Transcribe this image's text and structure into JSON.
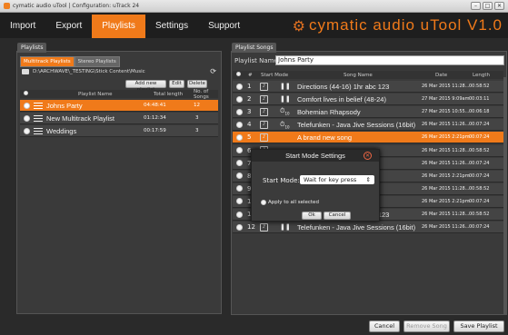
{
  "window": {
    "title": "cymatic audio uTool | Configuration: uTrack 24"
  },
  "menu": [
    "Import",
    "Export",
    "Playlists",
    "Settings",
    "Support"
  ],
  "menu_active": "Playlists",
  "brand": "cymatic audio uTool V1.0",
  "playlists": {
    "section_label": "Playlists",
    "tabs": [
      "Multitrack Playlists",
      "Stereo Playlists"
    ],
    "path": "D:\\ARCHWAVE\\_TESTING\\Stick Content\\Music",
    "buttons": {
      "add": "Add new playlist",
      "edit": "Edit",
      "delete": "Delete"
    },
    "headers": {
      "name": "Playlist Name",
      "length": "Total length",
      "songs": "No. of Songs"
    },
    "rows": [
      {
        "name": "Johns Party",
        "length": "04:48:41",
        "songs": "12",
        "selected": true
      },
      {
        "name": "New Multitrack Playlist",
        "length": "01:12:34",
        "songs": "3",
        "selected": false
      },
      {
        "name": "Weddings",
        "length": "00:17:59",
        "songs": "3",
        "selected": false
      }
    ]
  },
  "songs": {
    "section_label": "Playlist Songs",
    "name_label": "Playlist Name:",
    "name_value": "Johns Party",
    "headers": {
      "num": "#",
      "mode": "Start Mode",
      "name": "Song Name",
      "date": "Date",
      "length": "Length"
    },
    "rows": [
      {
        "num": "1",
        "mode": "pause",
        "name": "Directions (44-16) 1hr abc 123",
        "date": "26 Mar 2015 11:28...",
        "length": "00:58:52"
      },
      {
        "num": "2",
        "mode": "pause",
        "name": "Comfort lives in belief (48-24)",
        "date": "27 Mar 2015 9:09am",
        "length": "00:03:11"
      },
      {
        "num": "3",
        "mode": "timer",
        "name": "Bohemian Rhapsody",
        "date": "27 Mar 2015 10:55...",
        "length": "00:06:18"
      },
      {
        "num": "4",
        "mode": "timer",
        "name": "Telefunken - Java Jive Sessions (16bit)",
        "date": "26 Mar 2015 11:26...",
        "length": "00:07:24"
      },
      {
        "num": "5",
        "mode": "",
        "name": "A brand new song",
        "date": "26 Mar 2015 2:21pm",
        "length": "00:07:24",
        "selected": true
      },
      {
        "num": "6",
        "mode": "",
        "name": "",
        "date": "26 Mar 2015 11:28...",
        "length": "00:58:52"
      },
      {
        "num": "7",
        "mode": "",
        "name": "ts (16bit)",
        "date": "26 Mar 2015 11:26...",
        "length": "00:07:24"
      },
      {
        "num": "8",
        "mode": "",
        "name": "",
        "date": "26 Mar 2015 2:21pm",
        "length": "00:07:24"
      },
      {
        "num": "9",
        "mode": "",
        "name": "23",
        "date": "26 Mar 2015 11:28...",
        "length": "00:58:52"
      },
      {
        "num": "10",
        "mode": "",
        "name": "",
        "date": "26 Mar 2015 2:21pm",
        "length": "00:07:24"
      },
      {
        "num": "11",
        "mode": "pause",
        "name": "Directions (44-16) 1hr abc 123",
        "date": "26 Mar 2015 11:28...",
        "length": "00:58:52"
      },
      {
        "num": "12",
        "mode": "pause",
        "name": "Telefunken - Java Jive Sessions (16bit)",
        "date": "26 Mar 2015 11:26...",
        "length": "00:07:24"
      }
    ]
  },
  "dialog": {
    "title": "Start Mode Settings",
    "label": "Start Mode:",
    "value": "Wait for key press",
    "apply_all": "Apply to all selected",
    "ok": "Ok",
    "cancel": "Cancel"
  },
  "footer": {
    "cancel": "Cancel",
    "remove": "Remove Song",
    "save": "Save Playlist"
  }
}
